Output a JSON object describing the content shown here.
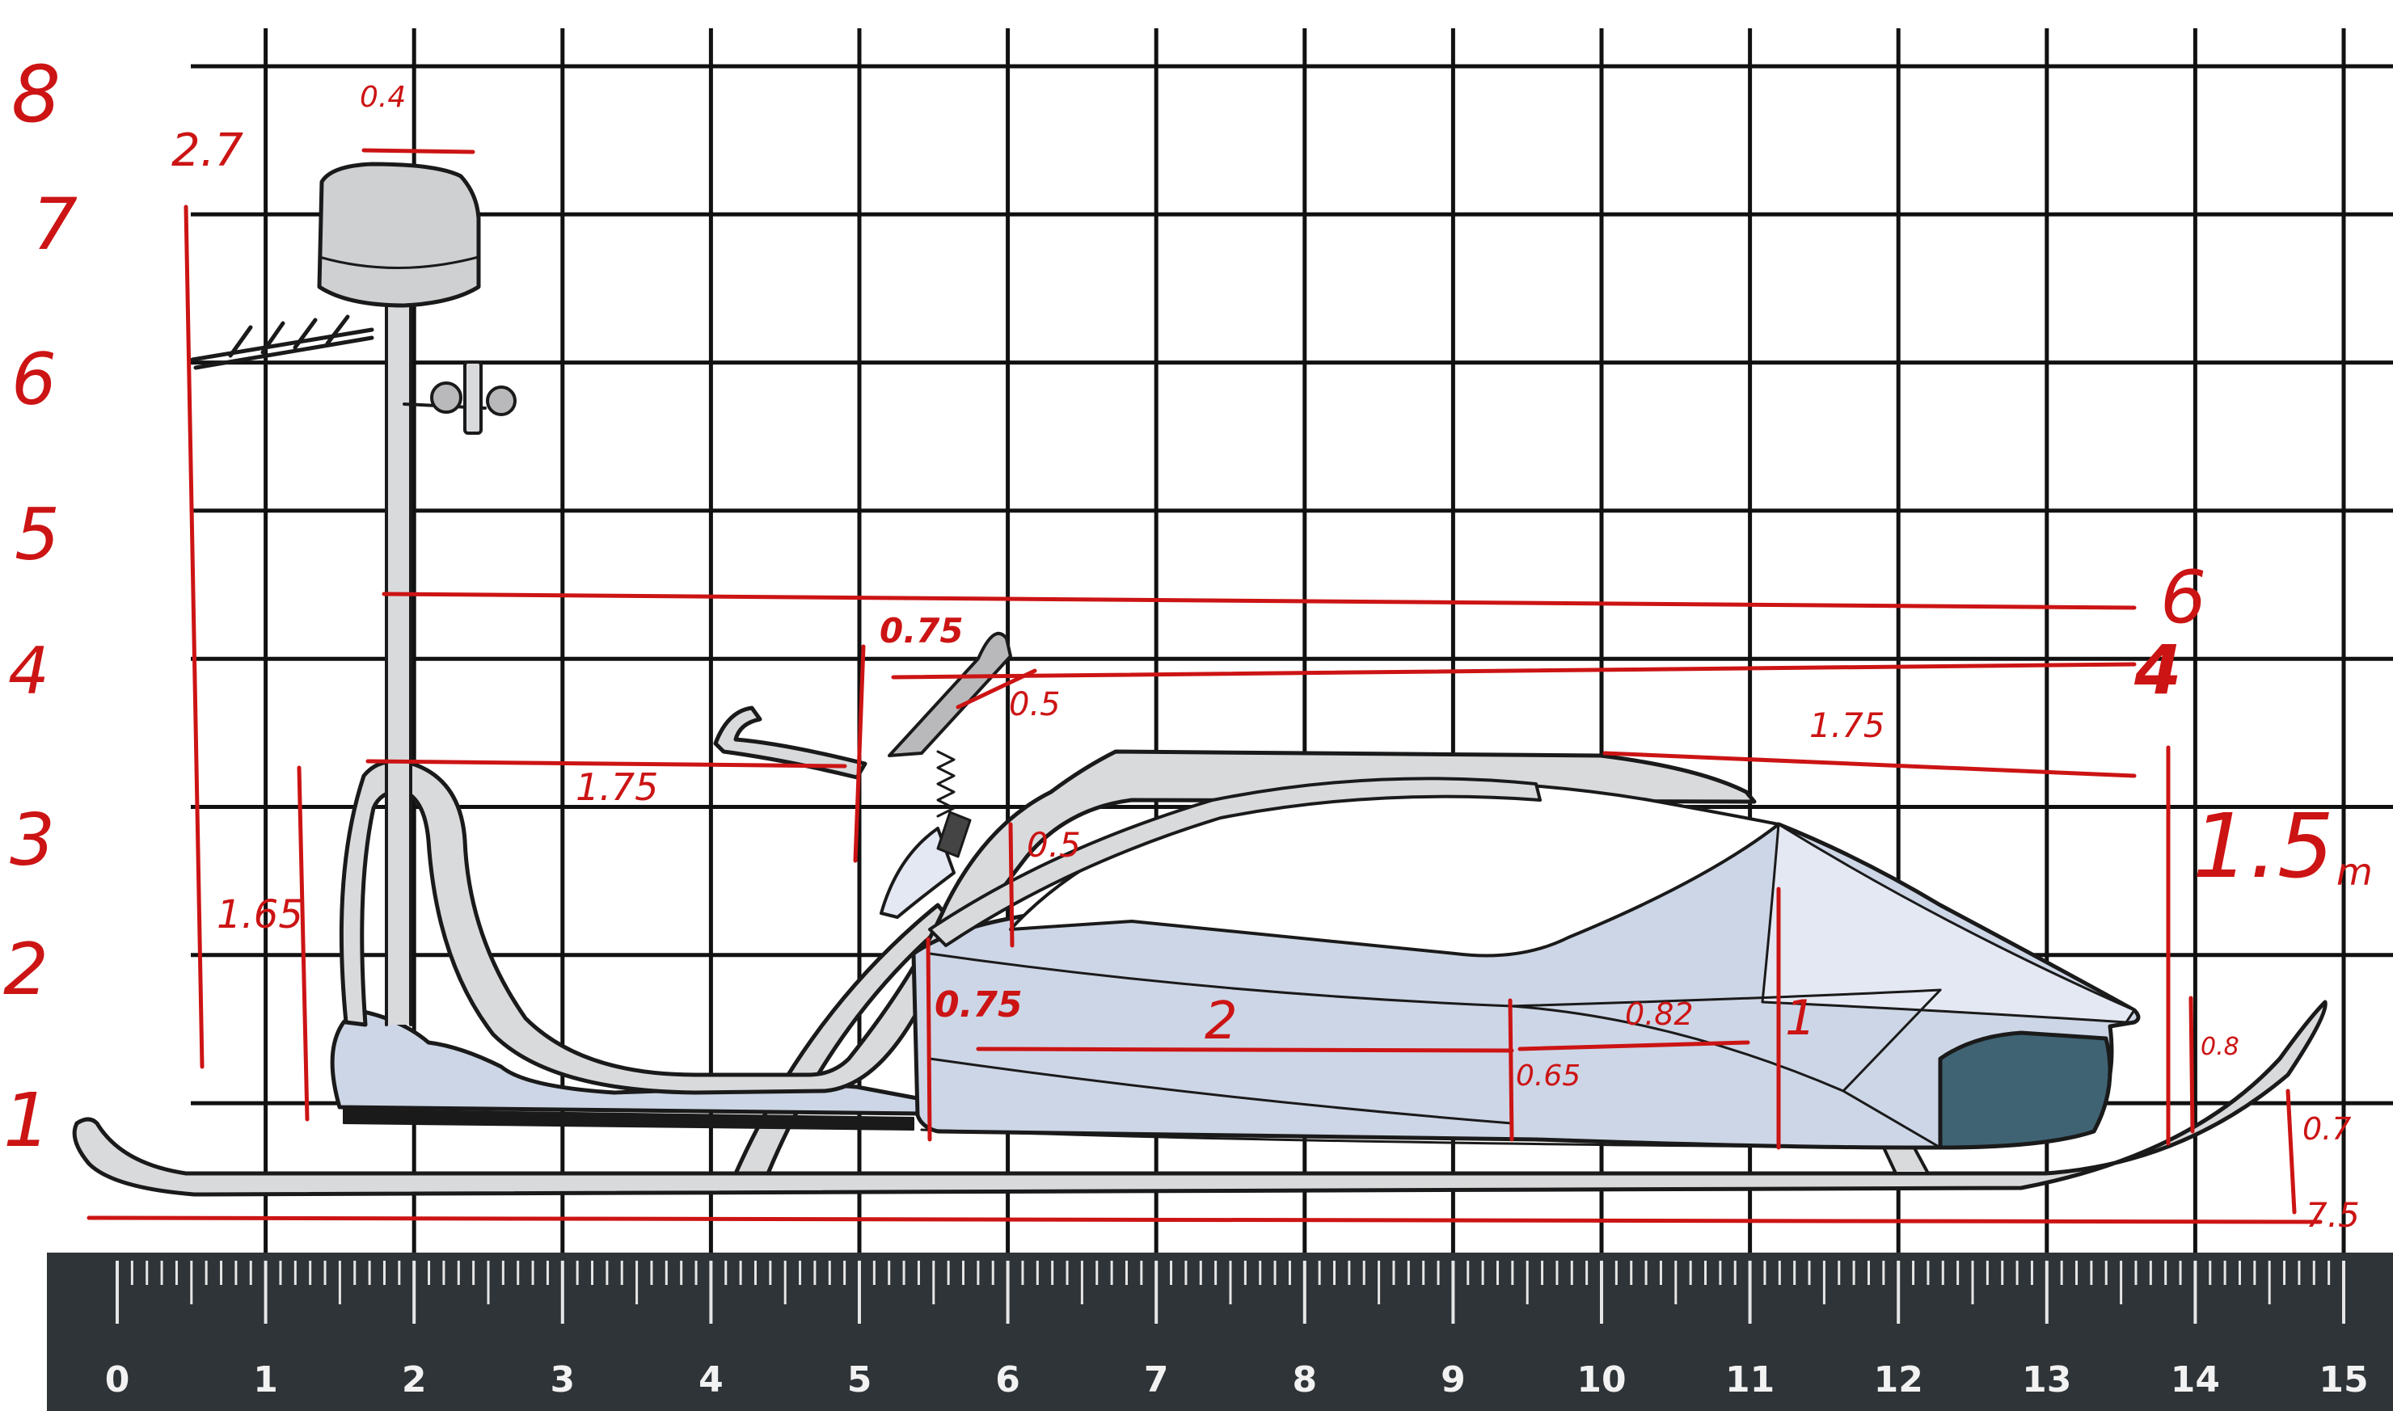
{
  "grid": {
    "columns": 15,
    "rows": 8,
    "line_color": "#111111"
  },
  "row_labels": [
    "8",
    "7",
    "6",
    "5",
    "4",
    "3",
    "2",
    "1"
  ],
  "ruler": {
    "labels": [
      "0",
      "1",
      "2",
      "3",
      "4",
      "5",
      "6",
      "7",
      "8",
      "9",
      "10",
      "11",
      "12",
      "13",
      "14",
      "15"
    ],
    "body_color": "#2e3438",
    "tick_color": "#e6e6e6"
  },
  "annotations": {
    "light_width": "0.4",
    "left_height": "2.7",
    "frame_height": "1.65",
    "handle_span": "1.75",
    "arm_top": "0.75",
    "arm_mid": "0.5",
    "strut": "0.5",
    "hull_front": "0.75",
    "hull_len": "2",
    "hull_mid": "0.65",
    "hull_step": "0.82",
    "hull_height": "1",
    "roof_len": "1.75",
    "level_6": "6",
    "level_4": "4",
    "total_height_val": "1.5",
    "total_height_unit": "m",
    "rear": "0.8",
    "ski_tip": "0.7",
    "total_len": "7.5"
  },
  "colors": {
    "annotation": "#cc1414",
    "frame": "#d9dadc",
    "hull": "#cdd6e6",
    "hull_dark": "#3f6373",
    "outline": "#1a1a1a"
  }
}
